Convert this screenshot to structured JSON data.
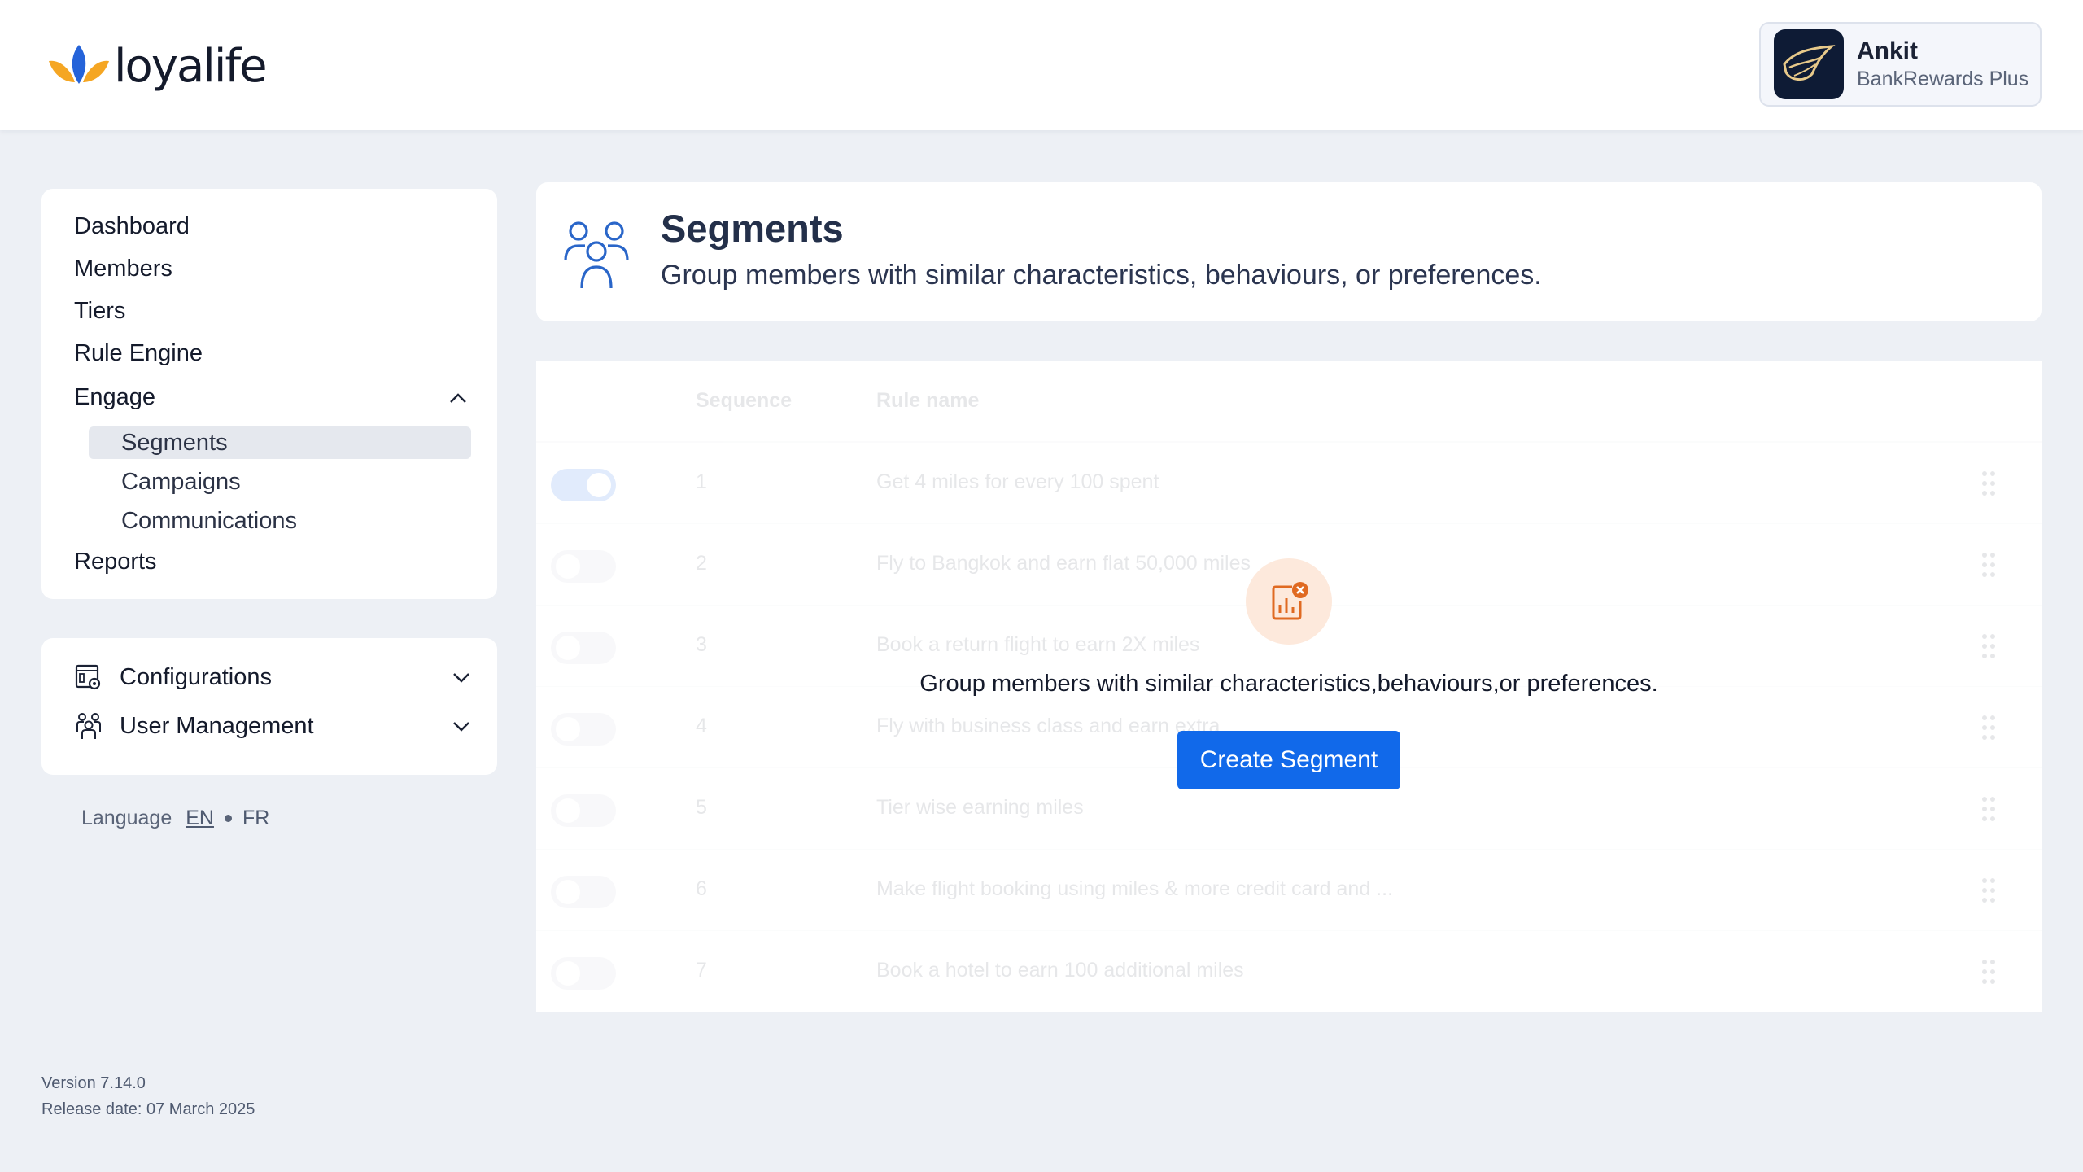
{
  "brand": {
    "name": "loyalife"
  },
  "user": {
    "name": "Ankit",
    "org": "BankRewards Plus"
  },
  "nav": {
    "items": [
      {
        "label": "Dashboard"
      },
      {
        "label": "Members"
      },
      {
        "label": "Tiers"
      },
      {
        "label": "Rule Engine"
      },
      {
        "label": "Engage",
        "expanded": true
      },
      {
        "label": "Reports"
      }
    ],
    "engage_children": [
      {
        "label": "Segments",
        "active": true
      },
      {
        "label": "Campaigns"
      },
      {
        "label": "Communications"
      }
    ]
  },
  "config_nav": [
    {
      "label": "Configurations",
      "icon": "settings-dashboard-icon"
    },
    {
      "label": "User Management",
      "icon": "users-group-icon"
    }
  ],
  "language": {
    "label": "Language",
    "options": [
      "EN",
      "FR"
    ],
    "selected": "EN"
  },
  "version": {
    "version": "Version 7.14.0",
    "release": "Release date: 07 March 2025"
  },
  "page": {
    "title": "Segments",
    "subtitle": "Group members with similar characteristics, behaviours, or preferences.",
    "icon": "users-group-icon"
  },
  "table": {
    "headers": [
      "Sequence",
      "Rule name"
    ],
    "rows": [
      {
        "seq": "1",
        "name": "Get 4 miles for every 100 spent",
        "enabled": true
      },
      {
        "seq": "2",
        "name": "Fly to Bangkok and earn flat 50,000 miles",
        "enabled": false
      },
      {
        "seq": "3",
        "name": "Book a return flight to earn 2X miles",
        "enabled": false
      },
      {
        "seq": "4",
        "name": "Fly with business class and earn extra",
        "enabled": false
      },
      {
        "seq": "5",
        "name": "Tier wise earning miles",
        "enabled": false
      },
      {
        "seq": "6",
        "name": "Make flight booking using miles & more credit card and ...",
        "enabled": false
      },
      {
        "seq": "7",
        "name": "Book a hotel to earn 100 additional miles",
        "enabled": false
      }
    ]
  },
  "empty_state": {
    "icon": "report-error-icon",
    "text": "Group members with similar characteristics,behaviours,or preferences.",
    "button": "Create Segment"
  },
  "colors": {
    "accent": "#1169ea",
    "background": "#edf0f5",
    "empty_icon_bg": "#fde9dc",
    "empty_icon_fg": "#e06a22",
    "brand_blue": "#2563d9",
    "brand_orange": "#f5a623"
  }
}
